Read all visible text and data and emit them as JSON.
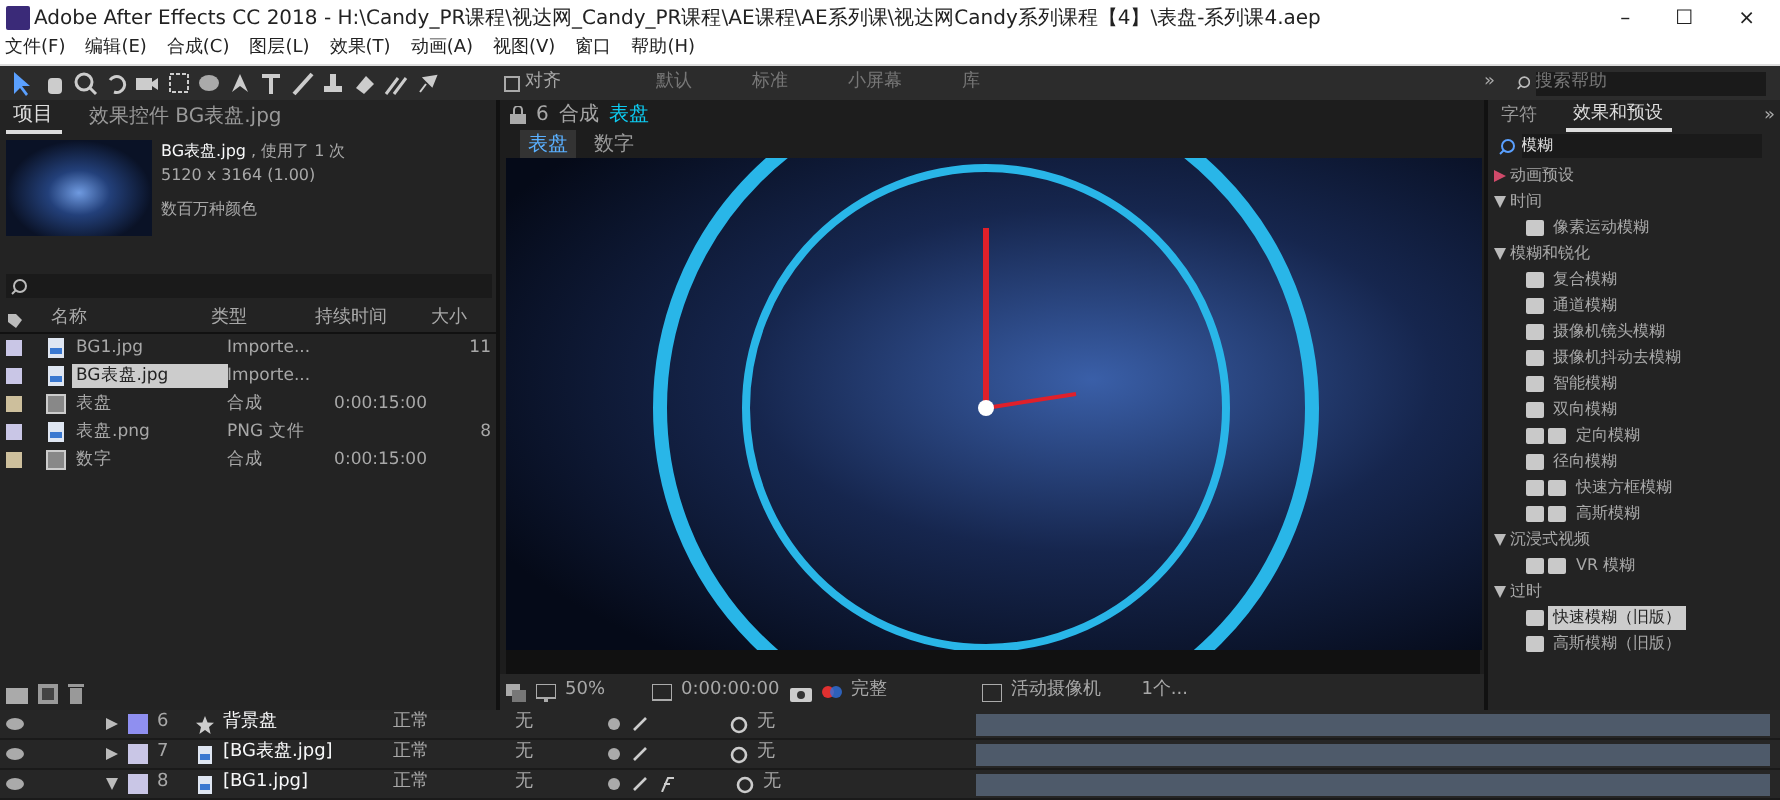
{
  "window": {
    "title": "Adobe After Effects CC 2018 - H:\\Candy_PR课程\\视达网_Candy_PR课程\\AE课程\\AE系列课\\视达网Candy系列课程【4】\\表盘-系列课4.aep",
    "controls": [
      "–",
      "☐",
      "×"
    ]
  },
  "menu": [
    "文件(F)",
    "编辑(E)",
    "合成(C)",
    "图层(L)",
    "效果(T)",
    "动画(A)",
    "视图(V)",
    "窗口",
    "帮助(H)"
  ],
  "toolbar": {
    "snap": {
      "label": "对齐",
      "checked": false
    },
    "workspaces": [
      {
        "label": "默认",
        "selected": false
      },
      {
        "label": "标准",
        "selected": false
      },
      {
        "label": "小屏幕",
        "selected": false
      },
      {
        "label": "库",
        "selected": false
      }
    ],
    "more": "»",
    "search": {
      "placeholder": "搜索帮助"
    }
  },
  "project_panel": {
    "tabs": [
      {
        "label": "项目",
        "selected": true
      },
      {
        "label": "效果控件 BG表盘.jpg",
        "selected": false
      }
    ],
    "preview": {
      "name": "BG表盘.jpg",
      "usage": ", 使用了 1 次",
      "dimensions": "5120 x 3164 (1.00)",
      "colors": "数百万种颜色"
    },
    "columns": [
      "名称",
      "类型",
      "持续时间",
      "大小"
    ],
    "items": [
      {
        "kind": "footage",
        "name": "BG1.jpg",
        "type": "Importe...",
        "size": "11",
        "color": "#c9c6e6",
        "selected": false
      },
      {
        "kind": "footage",
        "name": "BG表盘.jpg",
        "type": "Importe...",
        "color": "#c9c6e6",
        "selected": true
      },
      {
        "kind": "comp",
        "name": "表盘",
        "type": "合成",
        "duration": "0:00:15:00",
        "color": "#cdbf9c",
        "selected": false
      },
      {
        "kind": "footage",
        "name": "表盘.png",
        "type": "PNG 文件",
        "size": "8",
        "color": "#c9c6e6",
        "selected": false
      },
      {
        "kind": "comp",
        "name": "数字",
        "type": "合成",
        "duration": "0:00:15:00",
        "color": "#cdbf9c",
        "selected": false
      }
    ]
  },
  "viewer": {
    "number": "6",
    "comp_label": "合成",
    "comp_name": "表盘",
    "tabs": [
      {
        "label": "表盘",
        "selected": true
      },
      {
        "label": "数字",
        "selected": false
      }
    ],
    "footer": {
      "zoom": "50%",
      "timecode": "0:00:00:00",
      "quality": "完整",
      "camera": "活动摄像机",
      "views": "1个..."
    }
  },
  "effects_panel": {
    "tabs": [
      {
        "label": "字符",
        "selected": false
      },
      {
        "label": "效果和预设",
        "selected": true
      }
    ],
    "more": "»",
    "search": {
      "value": "模糊"
    },
    "tree": [
      {
        "kind": "folder",
        "label": "动画预设",
        "expanded": false
      },
      {
        "kind": "folder",
        "label": "时间",
        "expanded": true,
        "children": [
          {
            "kind": "effect",
            "label": "像素运动模糊",
            "dual": false,
            "selected": false
          }
        ]
      },
      {
        "kind": "folder",
        "label": "模糊和锐化",
        "expanded": true,
        "children": [
          {
            "kind": "effect",
            "label": "复合模糊",
            "dual": false,
            "selected": false
          },
          {
            "kind": "effect",
            "label": "通道模糊",
            "dual": false,
            "selected": false
          },
          {
            "kind": "effect",
            "label": "摄像机镜头模糊",
            "dual": false,
            "selected": false
          },
          {
            "kind": "effect",
            "label": "摄像机抖动去模糊",
            "dual": false,
            "selected": false
          },
          {
            "kind": "effect",
            "label": "智能模糊",
            "dual": false,
            "selected": false
          },
          {
            "kind": "effect",
            "label": "双向模糊",
            "dual": false,
            "selected": false
          },
          {
            "kind": "effect",
            "label": "定向模糊",
            "dual": true,
            "selected": false
          },
          {
            "kind": "effect",
            "label": "径向模糊",
            "dual": false,
            "selected": false
          },
          {
            "kind": "effect",
            "label": "快速方框模糊",
            "dual": true,
            "selected": false
          },
          {
            "kind": "effect",
            "label": "高斯模糊",
            "dual": true,
            "selected": false
          }
        ]
      },
      {
        "kind": "folder",
        "label": "沉浸式视频",
        "expanded": true,
        "children": [
          {
            "kind": "effect",
            "label": "VR 模糊",
            "dual": true,
            "selected": false
          }
        ]
      },
      {
        "kind": "folder",
        "label": "过时",
        "expanded": true,
        "children": [
          {
            "kind": "effect",
            "label": "快速模糊（旧版）",
            "dual": false,
            "selected": true
          },
          {
            "kind": "effect",
            "label": "高斯模糊（旧版）",
            "dual": false,
            "selected": false
          }
        ]
      }
    ]
  },
  "timeline": {
    "layers": [
      {
        "number": "6",
        "kind": "comp",
        "name": "背景盘",
        "color": "#8f8ff0",
        "expanded": false,
        "mode": "正常",
        "trkmat": "无",
        "parent": "无",
        "fx": false
      },
      {
        "number": "7",
        "kind": "footage",
        "name": "[BG表盘.jpg]",
        "color": "#c9c6e6",
        "expanded": false,
        "mode": "正常",
        "trkmat": "无",
        "parent": "无",
        "fx": false
      },
      {
        "number": "8",
        "kind": "footage",
        "name": "[BG1.jpg]",
        "color": "#c9c6e6",
        "expanded": true,
        "mode": "正常",
        "trkmat": "无",
        "parent": "无",
        "fx": true
      }
    ]
  }
}
